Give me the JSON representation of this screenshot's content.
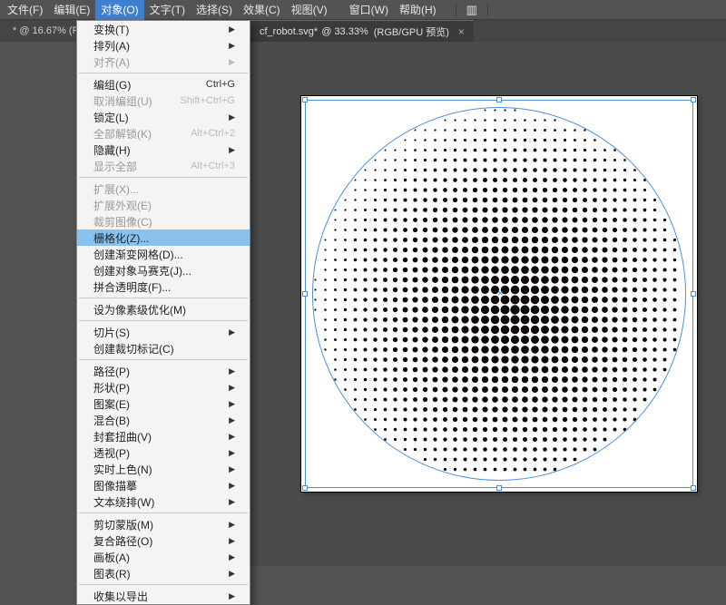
{
  "menubar": {
    "items": [
      {
        "label": "文件(F)"
      },
      {
        "label": "编辑(E)"
      },
      {
        "label": "对象(O)"
      },
      {
        "label": "文字(T)"
      },
      {
        "label": "选择(S)"
      },
      {
        "label": "效果(C)"
      },
      {
        "label": "视图(V)"
      },
      {
        "label": "窗口(W)"
      },
      {
        "label": "帮助(H)"
      }
    ],
    "active_index": 2
  },
  "tabs": {
    "left_fragment": "* @ 16.67%  (R",
    "active": {
      "name": "cf_robot.svg*",
      "zoom": "33.33%",
      "mode": "RGB/GPU 预览"
    }
  },
  "dropdown": [
    {
      "type": "item",
      "label": "变换(T)",
      "submenu": true
    },
    {
      "type": "item",
      "label": "排列(A)",
      "submenu": true
    },
    {
      "type": "item",
      "label": "对齐(A)",
      "submenu": true,
      "disabled": true
    },
    {
      "type": "sep"
    },
    {
      "type": "item",
      "label": "编组(G)",
      "shortcut": "Ctrl+G"
    },
    {
      "type": "item",
      "label": "取消编组(U)",
      "shortcut": "Shift+Ctrl+G",
      "disabled": true
    },
    {
      "type": "item",
      "label": "锁定(L)",
      "submenu": true
    },
    {
      "type": "item",
      "label": "全部解锁(K)",
      "shortcut": "Alt+Ctrl+2",
      "disabled": true
    },
    {
      "type": "item",
      "label": "隐藏(H)",
      "submenu": true
    },
    {
      "type": "item",
      "label": "显示全部",
      "shortcut": "Alt+Ctrl+3",
      "disabled": true
    },
    {
      "type": "sep"
    },
    {
      "type": "item",
      "label": "扩展(X)...",
      "disabled": true
    },
    {
      "type": "item",
      "label": "扩展外观(E)",
      "disabled": true
    },
    {
      "type": "item",
      "label": "裁剪图像(C)",
      "disabled": true
    },
    {
      "type": "item",
      "label": "栅格化(Z)...",
      "highlight": true
    },
    {
      "type": "item",
      "label": "创建渐变网格(D)..."
    },
    {
      "type": "item",
      "label": "创建对象马赛克(J)..."
    },
    {
      "type": "item",
      "label": "拼合透明度(F)..."
    },
    {
      "type": "sep"
    },
    {
      "type": "item",
      "label": "设为像素级优化(M)"
    },
    {
      "type": "sep"
    },
    {
      "type": "item",
      "label": "切片(S)",
      "submenu": true
    },
    {
      "type": "item",
      "label": "创建裁切标记(C)"
    },
    {
      "type": "sep"
    },
    {
      "type": "item",
      "label": "路径(P)",
      "submenu": true
    },
    {
      "type": "item",
      "label": "形状(P)",
      "submenu": true
    },
    {
      "type": "item",
      "label": "图案(E)",
      "submenu": true
    },
    {
      "type": "item",
      "label": "混合(B)",
      "submenu": true
    },
    {
      "type": "item",
      "label": "封套扭曲(V)",
      "submenu": true
    },
    {
      "type": "item",
      "label": "透视(P)",
      "submenu": true
    },
    {
      "type": "item",
      "label": "实时上色(N)",
      "submenu": true
    },
    {
      "type": "item",
      "label": "图像描摹",
      "submenu": true
    },
    {
      "type": "item",
      "label": "文本绕排(W)",
      "submenu": true
    },
    {
      "type": "sep"
    },
    {
      "type": "item",
      "label": "剪切蒙版(M)",
      "submenu": true
    },
    {
      "type": "item",
      "label": "复合路径(O)",
      "submenu": true
    },
    {
      "type": "item",
      "label": "画板(A)",
      "submenu": true
    },
    {
      "type": "item",
      "label": "图表(R)",
      "submenu": true
    },
    {
      "type": "sep"
    },
    {
      "type": "item",
      "label": "收集以导出",
      "submenu": true
    }
  ]
}
